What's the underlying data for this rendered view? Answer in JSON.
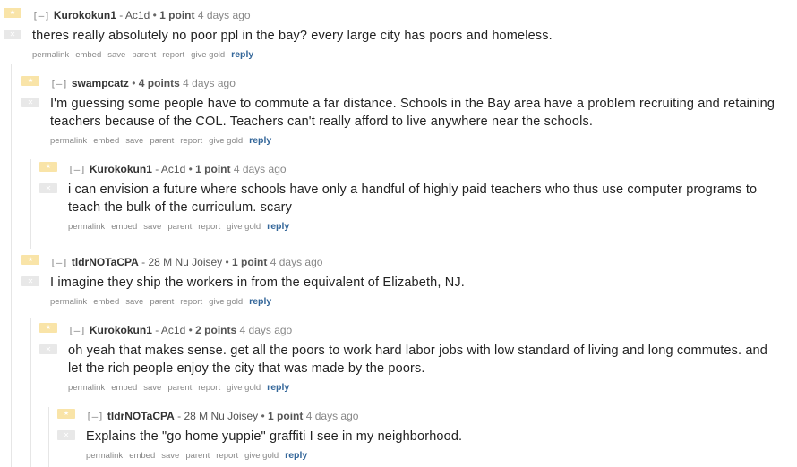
{
  "toggle_symbol": "[–]",
  "action_labels": {
    "permalink": "permalink",
    "embed": "embed",
    "save": "save",
    "parent": "parent",
    "report": "report",
    "give_gold": "give gold",
    "reply": "reply"
  },
  "colors": {
    "upvote": "#f9e4a8",
    "downvote": "#e8e8e8",
    "reply_link": "#336699",
    "rail": "#e6e6e6"
  },
  "comments": [
    {
      "author": "Kurokokun1",
      "flair_sep": "-",
      "flair": "Ac1d",
      "bullet": "•",
      "score": "1 point",
      "time": "4 days ago",
      "text": "theres really absolutely no poor ppl in the bay? every large city has poors and homeless."
    },
    {
      "author": "swampcatz",
      "flair_sep": "",
      "flair": "",
      "bullet": "•",
      "score": "4 points",
      "time": "4 days ago",
      "text": "I'm guessing some people have to commute a far distance. Schools in the Bay area have a problem recruiting and retaining teachers because of the COL. Teachers can't really afford to live anywhere near the schools."
    },
    {
      "author": "Kurokokun1",
      "flair_sep": "-",
      "flair": "Ac1d",
      "bullet": "•",
      "score": "1 point",
      "time": "4 days ago",
      "text": "i can envision a future where schools have only a handful of highly paid teachers who thus use computer programs to teach the bulk of the curriculum. scary"
    },
    {
      "author": "tldrNOTaCPA",
      "flair_sep": "-",
      "flair": "28 M Nu Joisey",
      "bullet": "•",
      "score": "1 point",
      "time": "4 days ago",
      "text": "I imagine they ship the workers in from the equivalent of Elizabeth, NJ."
    },
    {
      "author": "Kurokokun1",
      "flair_sep": "-",
      "flair": "Ac1d",
      "bullet": "•",
      "score": "2 points",
      "time": "4 days ago",
      "text": "oh yeah that makes sense. get all the poors to work hard labor jobs with low standard of living and long commutes. and let the rich people enjoy the city that was made by the poors."
    },
    {
      "author": "tldrNOTaCPA",
      "flair_sep": "-",
      "flair": "28 M Nu Joisey",
      "bullet": "•",
      "score": "1 point",
      "time": "4 days ago",
      "text": "Explains the \"go home yuppie\" graffiti I see in my neighborhood."
    }
  ]
}
